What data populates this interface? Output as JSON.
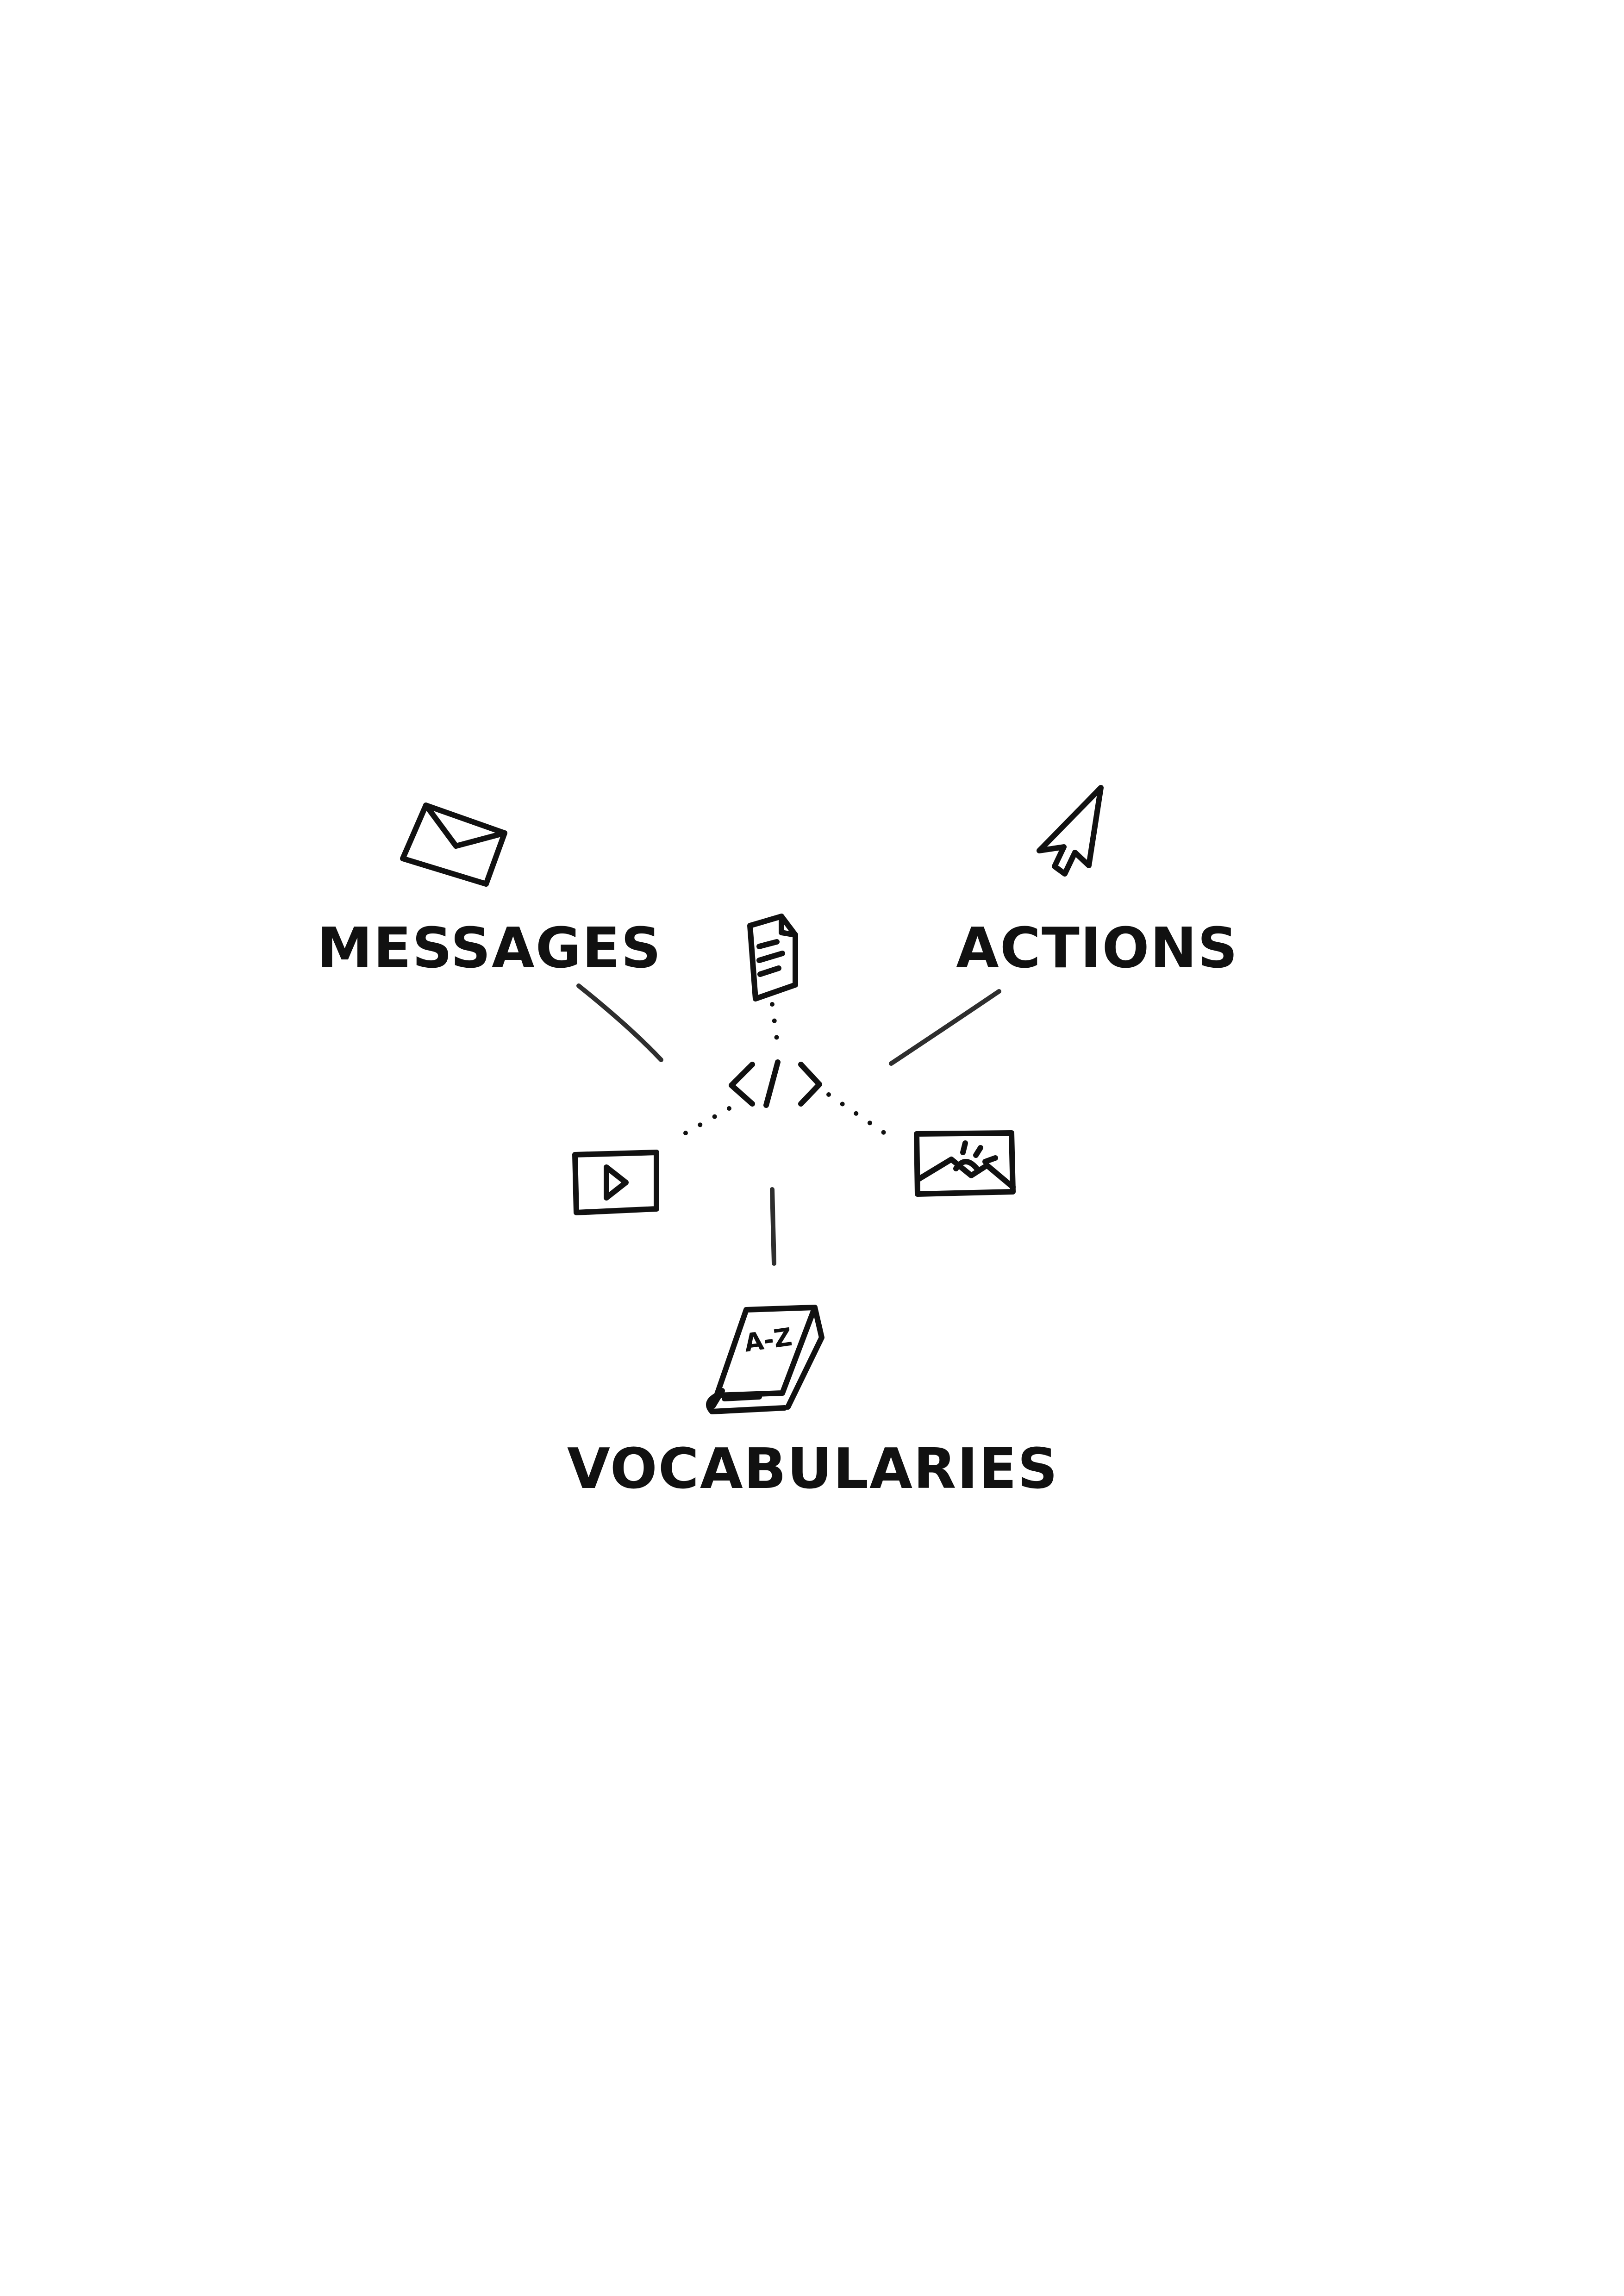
{
  "labels": {
    "messages": "MESSAGES",
    "actions": "ACTIONS",
    "vocabularies": "VOCABULARIES"
  },
  "book_cover_text": "A-Z",
  "icons": {
    "messages": "envelope-icon",
    "actions": "cursor-arrow-icon",
    "vocabularies": "book-icon",
    "center": "code-brackets-icon",
    "document": "document-icon",
    "video": "video-play-icon",
    "image": "image-icon"
  },
  "colors": {
    "ink": "#111111",
    "background": "#ffffff"
  }
}
